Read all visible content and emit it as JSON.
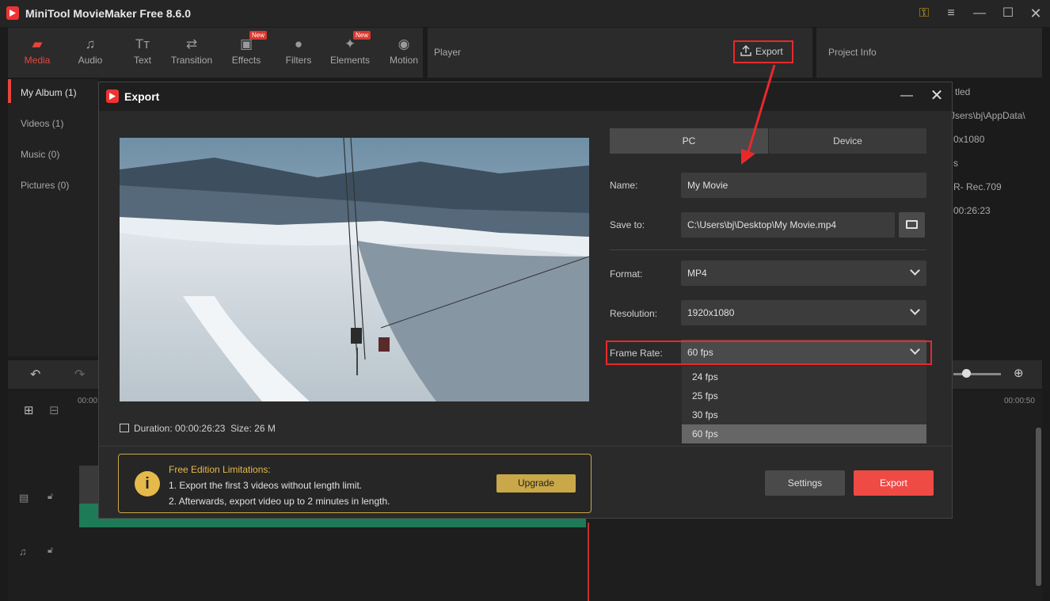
{
  "app": {
    "title": "MiniTool MovieMaker Free 8.6.0"
  },
  "toolbar": {
    "tabs": [
      {
        "label": "Media",
        "icon": "media-icon",
        "active": true
      },
      {
        "label": "Audio",
        "icon": "music-note-icon"
      },
      {
        "label": "Text",
        "icon": "text-icon"
      },
      {
        "label": "Transition",
        "icon": "transition-icon"
      },
      {
        "label": "Effects",
        "icon": "effects-icon",
        "badge": "New"
      },
      {
        "label": "Filters",
        "icon": "filters-icon"
      },
      {
        "label": "Elements",
        "icon": "elements-icon",
        "badge": "New"
      },
      {
        "label": "Motion",
        "icon": "motion-icon"
      }
    ]
  },
  "player": {
    "label": "Player",
    "export_label": "Export"
  },
  "project_info": {
    "label": "Project Info",
    "values": [
      "tled",
      "Jsers\\bj\\AppData\\",
      "0x1080",
      "s",
      "R- Rec.709",
      "00:26:23"
    ]
  },
  "media": {
    "items": [
      {
        "label": "My Album  (1)",
        "active": true
      },
      {
        "label": "Videos  (1)"
      },
      {
        "label": "Music  (0)"
      },
      {
        "label": "Pictures  (0)"
      }
    ]
  },
  "timeline": {
    "ruler_left": "00:00",
    "ruler_right": "00:00:50"
  },
  "dialog": {
    "title": "Export",
    "duration_label": "Duration:",
    "duration_value": "00:00:26:23",
    "size_label": "Size:",
    "size_value": "26 M",
    "tabs": {
      "pc": "PC",
      "device": "Device"
    },
    "form": {
      "name_label": "Name:",
      "name_value": "My Movie",
      "saveto_label": "Save to:",
      "saveto_value": "C:\\Users\\bj\\Desktop\\My Movie.mp4",
      "format_label": "Format:",
      "format_value": "MP4",
      "resolution_label": "Resolution:",
      "resolution_value": "1920x1080",
      "framerate_label": "Frame Rate:",
      "framerate_value": "60 fps",
      "framerate_options": [
        "24 fps",
        "25 fps",
        "30 fps",
        "60 fps"
      ]
    },
    "limitations": {
      "title": "Free Edition Limitations:",
      "line1": "1. Export the first 3 videos without length limit.",
      "line2": "2. Afterwards, export video up to 2 minutes in length.",
      "upgrade_label": "Upgrade"
    },
    "settings_label": "Settings",
    "export_label": "Export"
  },
  "colors": {
    "accent": "#e8453c",
    "export_button": "#f04a45",
    "highlight_annotation": "#e8292c",
    "limitation_gold": "#c9a849"
  }
}
